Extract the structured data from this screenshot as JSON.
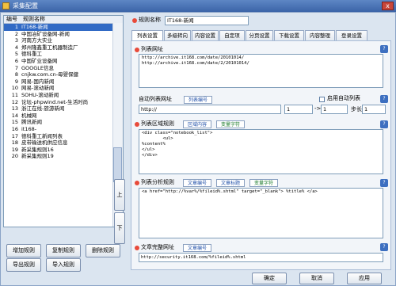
{
  "window": {
    "title": "采集配置",
    "close_label": "x"
  },
  "list": {
    "col_number": "编号",
    "col_name": "规则名称",
    "rows": [
      {
        "num": "1",
        "name": "IT168-新闻"
      },
      {
        "num": "2",
        "name": "中国冶矿设备网-新闻"
      },
      {
        "num": "3",
        "name": "河南方大实业"
      },
      {
        "num": "4",
        "name": "郑州隆鑫重工机器制造厂"
      },
      {
        "num": "5",
        "name": "德科重工"
      },
      {
        "num": "6",
        "name": "中国矿业设备网"
      },
      {
        "num": "7",
        "name": "GOOGLE信息"
      },
      {
        "num": "8",
        "name": "cnjkw.com.cn-母婴保健"
      },
      {
        "num": "9",
        "name": "网易-国内新闻"
      },
      {
        "num": "10",
        "name": "网易-滚动新闻"
      },
      {
        "num": "11",
        "name": "SOHU-滚动新闻"
      },
      {
        "num": "12",
        "name": "论坛-phpwind.net-生活时尚"
      },
      {
        "num": "13",
        "name": "浙江在线-旅游新闻"
      },
      {
        "num": "14",
        "name": "机械网"
      },
      {
        "num": "15",
        "name": "腾讯新闻"
      },
      {
        "num": "16",
        "name": "it168-"
      },
      {
        "num": "17",
        "name": "德科重工新闻列表"
      },
      {
        "num": "18",
        "name": "皮带输送机供应信息"
      },
      {
        "num": "19",
        "name": "新采集规则16"
      },
      {
        "num": "20",
        "name": "新采集规则19"
      }
    ]
  },
  "buttons": {
    "up": "上",
    "down": "下",
    "add_rule": "增加规则",
    "copy_rule": "复制规则",
    "delete_rule": "删除规则",
    "export_rule": "导出规则",
    "import_rule": "导入规则",
    "ok": "确定",
    "cancel": "取消",
    "apply": "应用"
  },
  "rule_name": {
    "label": "规则名称",
    "value": "IT168-新闻"
  },
  "tabs": [
    "列表设置",
    "多级转向",
    "内容设置",
    "自定项",
    "分页设置",
    "下载设置",
    "内容整理",
    "登录设置"
  ],
  "list_url": {
    "label": "列表网址",
    "value": "http://archive.it168.com/date/20101014/\nhttp://archive.it168.com/date/2/20101014/"
  },
  "auto_url": {
    "label": "自动列表网址",
    "number_btn": "列表编号",
    "prefix": "http://",
    "from": "1",
    "arrow": "->",
    "to": "1",
    "enable_label": "启用自动列表",
    "step_label": "步长",
    "step_value": "1"
  },
  "list_area": {
    "label": "列表区域规则",
    "btn_area": "区域内容",
    "btn_var": "变量字符",
    "value": "<div class=\"notebook_list\">\n        <ul>\n%content%\n</ul>\n</div>"
  },
  "list_parse": {
    "label": "列表分析规则",
    "btn_number": "文章编号",
    "btn_title": "文章标题",
    "btn_var": "变量字符",
    "value": "<a href=\"http://%var%/%fileid%.shtml\" target=\"_blank\"> %title% </a>"
  },
  "full_url": {
    "label": "文章完整网址",
    "btn_number": "文章编号",
    "value": "http://security.it168.com/%fileid%.shtml"
  },
  "colors": {
    "selection": "#316ac5",
    "accent_red": "#e84a3a",
    "title_blue": "#3b64a8"
  }
}
